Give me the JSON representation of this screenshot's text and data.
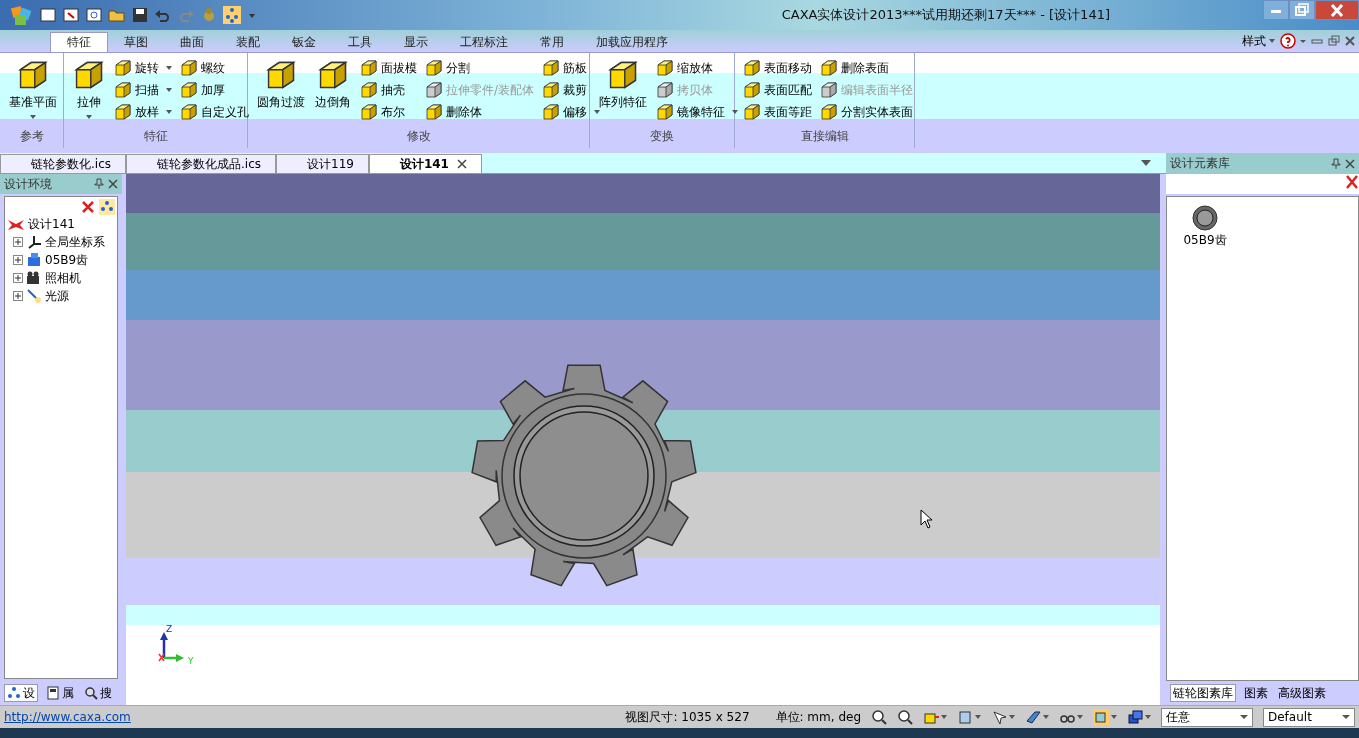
{
  "window": {
    "title": "CAXA实体设计2013***试用期还剩17天***  - [设计141]"
  },
  "ribbon_tabs": [
    {
      "label": "特征",
      "selected": true
    },
    {
      "label": "草图",
      "selected": false
    },
    {
      "label": "曲面",
      "selected": false
    },
    {
      "label": "装配",
      "selected": false
    },
    {
      "label": "钣金",
      "selected": false
    },
    {
      "label": "工具",
      "selected": false
    },
    {
      "label": "显示",
      "selected": false
    },
    {
      "label": "工程标注",
      "selected": false
    },
    {
      "label": "常用",
      "selected": false
    },
    {
      "label": "加载应用程序",
      "selected": false
    }
  ],
  "style_menu": {
    "label": "样式"
  },
  "ribbon": {
    "groups": [
      {
        "label": "参考",
        "columns": [
          {
            "kind": "large",
            "items": [
              {
                "label": "基准平面",
                "dropdown": true,
                "disabled": false
              }
            ]
          }
        ]
      },
      {
        "label": "特征",
        "columns": [
          {
            "kind": "large",
            "items": [
              {
                "label": "拉伸",
                "dropdown": true,
                "disabled": false
              }
            ]
          },
          {
            "kind": "small",
            "items": [
              {
                "label": "旋转",
                "dropdown": true,
                "disabled": false
              },
              {
                "label": "扫描",
                "dropdown": true,
                "disabled": false
              },
              {
                "label": "放样",
                "dropdown": true,
                "disabled": false
              }
            ]
          },
          {
            "kind": "small",
            "items": [
              {
                "label": "螺纹",
                "dropdown": false,
                "disabled": false
              },
              {
                "label": "加厚",
                "dropdown": false,
                "disabled": false
              },
              {
                "label": "自定义孔",
                "dropdown": false,
                "disabled": false
              }
            ]
          }
        ]
      },
      {
        "label": "修改",
        "columns": [
          {
            "kind": "large",
            "items": [
              {
                "label": "圆角过渡",
                "dropdown": false,
                "disabled": false
              }
            ]
          },
          {
            "kind": "large",
            "items": [
              {
                "label": "边倒角",
                "dropdown": false,
                "disabled": false
              }
            ]
          },
          {
            "kind": "small",
            "items": [
              {
                "label": "面拔模",
                "dropdown": false,
                "disabled": false
              },
              {
                "label": "抽壳",
                "dropdown": false,
                "disabled": false
              },
              {
                "label": "布尔",
                "dropdown": false,
                "disabled": false
              }
            ]
          },
          {
            "kind": "small",
            "items": [
              {
                "label": "分割",
                "dropdown": false,
                "disabled": false
              },
              {
                "label": "拉伸零件/装配体",
                "dropdown": false,
                "disabled": true
              },
              {
                "label": "删除体",
                "dropdown": false,
                "disabled": false
              }
            ]
          },
          {
            "kind": "small",
            "items": [
              {
                "label": "筋板",
                "dropdown": false,
                "disabled": false
              },
              {
                "label": "裁剪",
                "dropdown": false,
                "disabled": false
              },
              {
                "label": "偏移",
                "dropdown": true,
                "disabled": false
              }
            ]
          }
        ]
      },
      {
        "label": "变换",
        "columns": [
          {
            "kind": "large",
            "items": [
              {
                "label": "阵列特征",
                "dropdown": false,
                "disabled": false
              }
            ]
          },
          {
            "kind": "small",
            "items": [
              {
                "label": "缩放体",
                "dropdown": false,
                "disabled": false
              },
              {
                "label": "拷贝体",
                "dropdown": false,
                "disabled": true
              },
              {
                "label": "镜像特征",
                "dropdown": true,
                "disabled": false
              }
            ]
          }
        ]
      },
      {
        "label": "直接编辑",
        "columns": [
          {
            "kind": "small",
            "items": [
              {
                "label": "表面移动",
                "dropdown": false,
                "disabled": false
              },
              {
                "label": "表面匹配",
                "dropdown": false,
                "disabled": false
              },
              {
                "label": "表面等距",
                "dropdown": false,
                "disabled": false
              }
            ]
          },
          {
            "kind": "small",
            "items": [
              {
                "label": "删除表面",
                "dropdown": false,
                "disabled": false
              },
              {
                "label": "编辑表面半径",
                "dropdown": false,
                "disabled": true
              },
              {
                "label": "分割实体表面",
                "dropdown": false,
                "disabled": false
              }
            ]
          }
        ]
      }
    ]
  },
  "doc_tabs": [
    {
      "label": "链轮参数化.ics",
      "selected": false
    },
    {
      "label": "链轮参数化成品.ics",
      "selected": false
    },
    {
      "label": "设计119",
      "selected": false
    },
    {
      "label": "设计141",
      "selected": true
    }
  ],
  "left_panel": {
    "title": "设计环境",
    "tree": {
      "label": "设计141",
      "children": [
        {
          "label": "全局坐标系",
          "expanded": false
        },
        {
          "label": "05B9齿",
          "expanded": false
        },
        {
          "label": "照相机",
          "expanded": false
        },
        {
          "label": "光源",
          "expanded": false
        }
      ]
    },
    "tabs": [
      {
        "label": "设",
        "selected": true
      },
      {
        "label": "属",
        "selected": false
      },
      {
        "label": "搜",
        "selected": false
      }
    ]
  },
  "viewport": {
    "axes": {
      "z": "Z",
      "y": "Y"
    }
  },
  "right_panel": {
    "title": "设计元素库",
    "items": [
      {
        "label": "05B9齿"
      }
    ],
    "tabs": [
      {
        "label": "链轮图素库",
        "selected": true
      },
      {
        "label": "图素",
        "selected": false
      },
      {
        "label": "高级图素",
        "selected": false
      }
    ]
  },
  "status_bar": {
    "link": "http://www.caxa.com",
    "view_size": "视图尺寸: 1035 x  527",
    "units": "单位: mm, deg",
    "selects": [
      {
        "value": "任意"
      },
      {
        "value": "Default"
      }
    ]
  }
}
